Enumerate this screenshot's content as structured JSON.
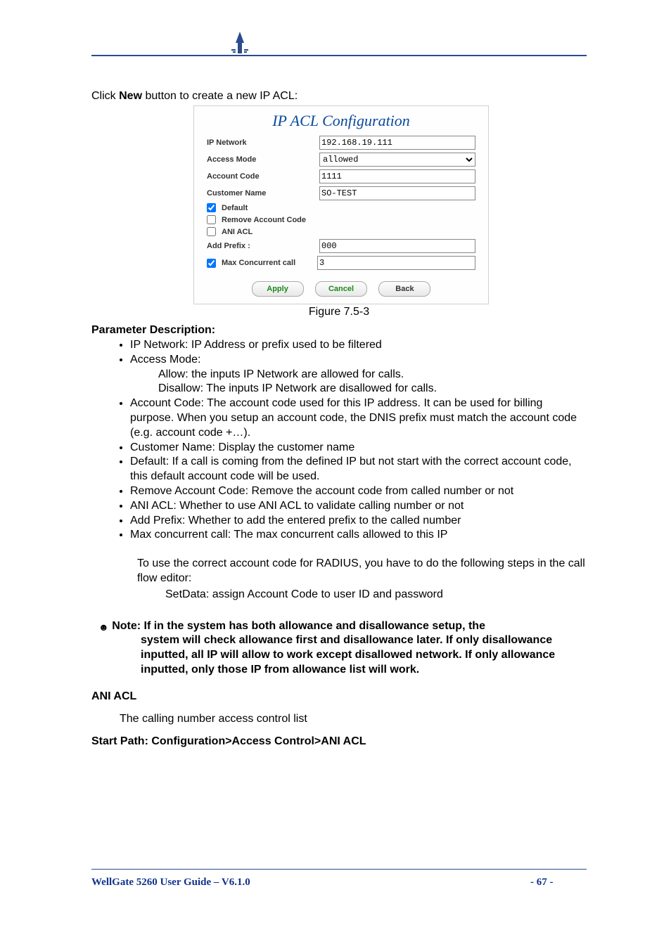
{
  "intro": {
    "prefix": "Click ",
    "bold": "New",
    "suffix": " button to create a new IP ACL:"
  },
  "form": {
    "title": "IP ACL Configuration",
    "ip_network_label": "IP Network",
    "ip_network_value": "192.168.19.111",
    "access_mode_label": "Access Mode",
    "access_mode_value": "allowed",
    "account_code_label": "Account Code",
    "account_code_value": "1111",
    "customer_name_label": "Customer Name",
    "customer_name_value": "SO-TEST",
    "default_label": "Default",
    "default_checked": true,
    "remove_acct_label": "Remove Account Code",
    "remove_acct_checked": false,
    "ani_acl_label": "ANI ACL",
    "ani_acl_checked": false,
    "add_prefix_label": "Add Prefix :",
    "add_prefix_value": "000",
    "max_conc_label": "Max Concurrent call",
    "max_conc_checked": true,
    "max_conc_value": "3",
    "btn_apply": "Apply",
    "btn_cancel": "Cancel",
    "btn_back": "Back"
  },
  "figure_caption": "Figure 7.5-3",
  "param_title": "Parameter Description:",
  "bullets": {
    "b1": "IP Network: IP Address or prefix used to be filtered",
    "b2": "Access Mode:",
    "b2a": "Allow: the inputs IP Network are allowed for calls.",
    "b2b": "Disallow: The inputs IP Network are disallowed for calls.",
    "b3": "Account Code: The account code used for this IP address. It can be used for billing purpose. When you setup an account code, the DNIS prefix must match the account code (e.g. account code +…).",
    "b4": "Customer Name: Display the customer name",
    "b5": "Default: If a call is coming from the defined IP but not start with the correct account code, this default account code will be used.",
    "b6": "Remove Account Code:  Remove the account code from called number or not",
    "b7": "ANI ACL: Whether to use ANI ACL to validate calling number or not",
    "b8": "Add Prefix: Whether to add the entered prefix to the called number",
    "b9": "Max concurrent call: The max concurrent calls allowed to this IP"
  },
  "followup": {
    "line1": "To use the correct account code for RADIUS, you have to do the following steps in the call flow editor:",
    "line2": "SetData: assign Account Code to user ID and password"
  },
  "note": {
    "lead": "Note: If in the system has both allowance and disallowance setup, the",
    "rest": "system will check allowance first and disallowance later. If only disallowance inputted, all IP will allow to work except disallowed network. If only allowance inputted, only those IP from allowance list will work."
  },
  "ani_heading": "ANI ACL",
  "ani_body": "The calling number access control list",
  "startpath": "Start Path: Configuration>Access Control>ANI ACL",
  "footer": {
    "left": "WellGate 5260 User Guide – V6.1.0",
    "page": "- 67 -"
  }
}
